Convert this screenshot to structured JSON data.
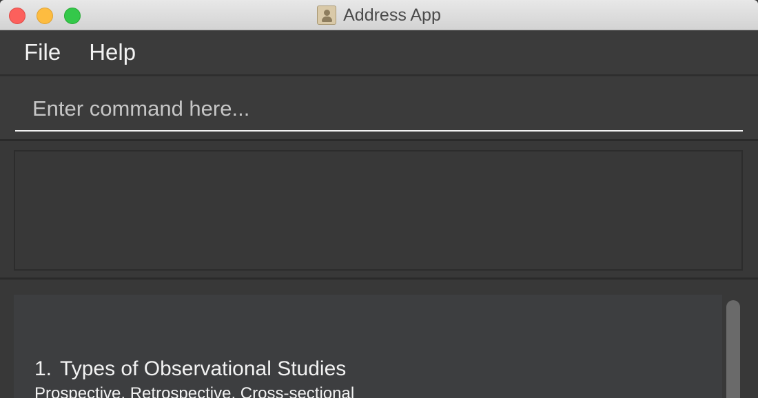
{
  "window": {
    "title": "Address App",
    "icon": "address-book-icon"
  },
  "menu": {
    "file": "File",
    "help": "Help"
  },
  "command": {
    "placeholder": "Enter command here...",
    "value": ""
  },
  "result": {
    "text": ""
  },
  "list": {
    "items": [
      {
        "index": "1.",
        "title": "Types of Observational Studies",
        "subtitle": "Prospective, Retrospective, Cross-sectional"
      }
    ]
  },
  "colors": {
    "background": "#383838",
    "card": "#3d3e40",
    "text": "#f2f2f2",
    "close": "#fc605c",
    "minimize": "#fdbc40",
    "maximize": "#34c84a"
  }
}
